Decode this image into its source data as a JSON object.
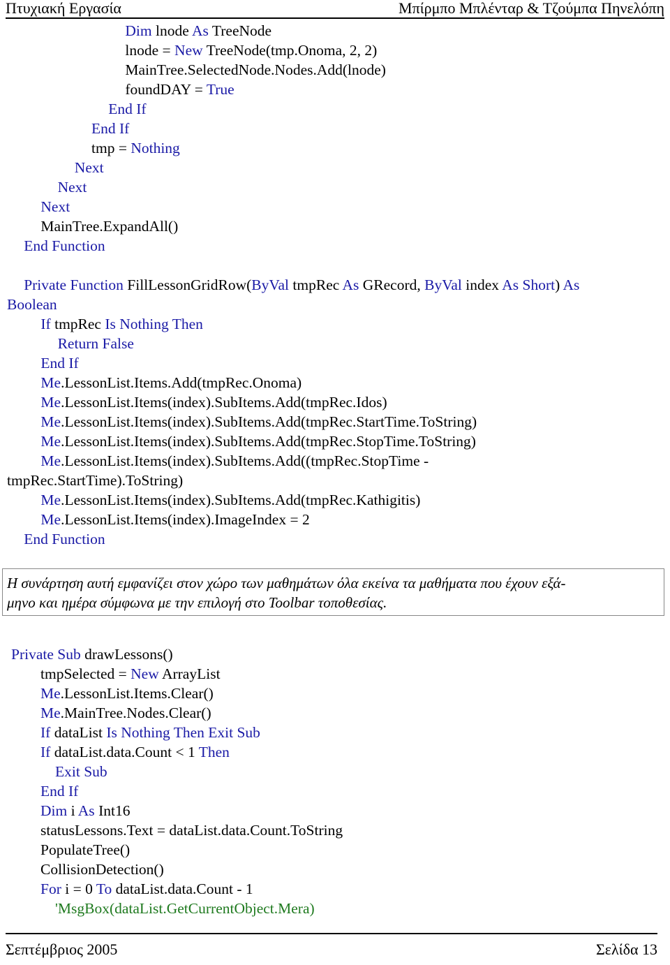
{
  "header": {
    "left": "Πτυχιακή Εργασία",
    "right": "Μπίρμπο Μπλένταρ & Τζούμπα Πηνελόπη"
  },
  "code_lines": [
    {
      "indent": 7,
      "segments": [
        {
          "t": "Dim",
          "k": "kw"
        },
        {
          "t": " lnode ",
          "k": "pl"
        },
        {
          "t": "As",
          "k": "kw"
        },
        {
          "t": " TreeNode",
          "k": "pl"
        }
      ]
    },
    {
      "indent": 7,
      "segments": [
        {
          "t": "lnode = ",
          "k": "pl"
        },
        {
          "t": "New",
          "k": "kw"
        },
        {
          "t": " TreeNode(tmp.Onoma, 2, 2)",
          "k": "pl"
        }
      ]
    },
    {
      "indent": 7,
      "segments": [
        {
          "t": "MainTree.SelectedNode.Nodes.Add(lnode)",
          "k": "pl"
        }
      ]
    },
    {
      "indent": 7,
      "segments": [
        {
          "t": "foundDAY = ",
          "k": "pl"
        },
        {
          "t": "True",
          "k": "kw"
        }
      ]
    },
    {
      "indent": 6,
      "segments": [
        {
          "t": "End If",
          "k": "kw"
        }
      ]
    },
    {
      "indent": 5,
      "segments": [
        {
          "t": "End If",
          "k": "kw"
        }
      ]
    },
    {
      "indent": 5,
      "segments": [
        {
          "t": "tmp = ",
          "k": "pl"
        },
        {
          "t": "Nothing",
          "k": "kw"
        }
      ]
    },
    {
      "indent": 4,
      "segments": [
        {
          "t": "Next",
          "k": "kw"
        }
      ]
    },
    {
      "indent": 3,
      "segments": [
        {
          "t": "Next",
          "k": "kw"
        }
      ]
    },
    {
      "indent": 2,
      "segments": [
        {
          "t": "Next",
          "k": "kw"
        }
      ]
    },
    {
      "indent": 2,
      "segments": [
        {
          "t": "MainTree.ExpandAll()",
          "k": "pl"
        }
      ]
    },
    {
      "indent": 1,
      "segments": [
        {
          "t": "End Function",
          "k": "kw"
        }
      ]
    },
    {
      "indent": 0,
      "segments": []
    },
    {
      "indent": 1,
      "segments": [
        {
          "t": "Private Function",
          "k": "kw"
        },
        {
          "t": " FillLessonGridRow(",
          "k": "pl"
        },
        {
          "t": "ByVal",
          "k": "kw"
        },
        {
          "t": " tmpRec ",
          "k": "pl"
        },
        {
          "t": "As",
          "k": "kw"
        },
        {
          "t": " GRecord, ",
          "k": "pl"
        },
        {
          "t": "ByVal",
          "k": "kw"
        },
        {
          "t": " index ",
          "k": "pl"
        },
        {
          "t": "As Short",
          "k": "kw"
        },
        {
          "t": ") ",
          "k": "pl"
        },
        {
          "t": "As",
          "k": "kw"
        }
      ]
    },
    {
      "indent": 0,
      "segments": [
        {
          "t": "Boolean",
          "k": "kw"
        }
      ]
    },
    {
      "indent": 2,
      "segments": [
        {
          "t": "If",
          "k": "kw"
        },
        {
          "t": " tmpRec ",
          "k": "pl"
        },
        {
          "t": "Is Nothing Then",
          "k": "kw"
        }
      ]
    },
    {
      "indent": 3,
      "segments": [
        {
          "t": "Return False",
          "k": "kw"
        }
      ]
    },
    {
      "indent": 2,
      "segments": [
        {
          "t": "End If",
          "k": "kw"
        }
      ]
    },
    {
      "indent": 2,
      "segments": [
        {
          "t": "Me",
          "k": "kw"
        },
        {
          "t": ".LessonList.Items.Add(tmpRec.Onoma)",
          "k": "pl"
        }
      ]
    },
    {
      "indent": 2,
      "segments": [
        {
          "t": "Me",
          "k": "kw"
        },
        {
          "t": ".LessonList.Items(index).SubItems.Add(tmpRec.Idos)",
          "k": "pl"
        }
      ]
    },
    {
      "indent": 2,
      "segments": [
        {
          "t": "Me",
          "k": "kw"
        },
        {
          "t": ".LessonList.Items(index).SubItems.Add(tmpRec.StartTime.ToString)",
          "k": "pl"
        }
      ]
    },
    {
      "indent": 2,
      "segments": [
        {
          "t": "Me",
          "k": "kw"
        },
        {
          "t": ".LessonList.Items(index).SubItems.Add(tmpRec.StopTime.ToString)",
          "k": "pl"
        }
      ]
    },
    {
      "indent": 2,
      "segments": [
        {
          "t": "Me",
          "k": "kw"
        },
        {
          "t": ".LessonList.Items(index).SubItems.Add((tmpRec.StopTime -",
          "k": "pl"
        }
      ]
    },
    {
      "indent": 0,
      "segments": [
        {
          "t": "tmpRec.StartTime).ToString)",
          "k": "pl"
        }
      ]
    },
    {
      "indent": 2,
      "segments": [
        {
          "t": "Me",
          "k": "kw"
        },
        {
          "t": ".LessonList.Items(index).SubItems.Add(tmpRec.Kathigitis)",
          "k": "pl"
        }
      ]
    },
    {
      "indent": 2,
      "segments": [
        {
          "t": "Me",
          "k": "kw"
        },
        {
          "t": ".LessonList.Items(index).ImageIndex = 2",
          "k": "pl"
        }
      ]
    },
    {
      "indent": 1,
      "segments": [
        {
          "t": "End Function",
          "k": "kw"
        }
      ]
    }
  ],
  "note": {
    "line1": "Η συνάρτηση αυτή εμφανίζει στον χώρο των μαθημάτων όλα εκείνα τα μαθήματα που έχουν εξά-",
    "line2": "μηνο και ημέρα σύμφωνα με την επιλογή  στο Toolbar τοποθεσίας."
  },
  "code_lines_2": [
    {
      "indent": 0,
      "segments": [
        {
          "t": "Private Sub",
          "k": "kw"
        },
        {
          "t": " drawLessons()",
          "k": "pl"
        }
      ]
    },
    {
      "indent": 2,
      "segments": [
        {
          "t": "tmpSelected = ",
          "k": "pl"
        },
        {
          "t": "New",
          "k": "kw"
        },
        {
          "t": " ArrayList",
          "k": "pl"
        }
      ]
    },
    {
      "indent": 2,
      "segments": [
        {
          "t": "Me",
          "k": "kw"
        },
        {
          "t": ".LessonList.Items.Clear()",
          "k": "pl"
        }
      ]
    },
    {
      "indent": 2,
      "segments": [
        {
          "t": "Me",
          "k": "kw"
        },
        {
          "t": ".MainTree.Nodes.Clear()",
          "k": "pl"
        }
      ]
    },
    {
      "indent": 2,
      "segments": [
        {
          "t": "If",
          "k": "kw"
        },
        {
          "t": " dataList ",
          "k": "pl"
        },
        {
          "t": "Is Nothing Then Exit Sub",
          "k": "kw"
        }
      ]
    },
    {
      "indent": 2,
      "segments": [
        {
          "t": "If",
          "k": "kw"
        },
        {
          "t": " dataList.data.Count < 1 ",
          "k": "pl"
        },
        {
          "t": "Then",
          "k": "kw"
        }
      ]
    },
    {
      "indent": 3,
      "segments": [
        {
          "t": "Exit Sub",
          "k": "kw"
        }
      ]
    },
    {
      "indent": 2,
      "segments": [
        {
          "t": "End If",
          "k": "kw"
        }
      ]
    },
    {
      "indent": 2,
      "segments": [
        {
          "t": "Dim",
          "k": "kw"
        },
        {
          "t": " i ",
          "k": "pl"
        },
        {
          "t": "As",
          "k": "kw"
        },
        {
          "t": " Int16",
          "k": "pl"
        }
      ]
    },
    {
      "indent": 2,
      "segments": [
        {
          "t": "statusLessons.Text = dataList.data.Count.ToString",
          "k": "pl"
        }
      ]
    },
    {
      "indent": 2,
      "segments": [
        {
          "t": "PopulateTree()",
          "k": "pl"
        }
      ]
    },
    {
      "indent": 2,
      "segments": [
        {
          "t": "CollisionDetection()",
          "k": "pl"
        }
      ]
    },
    {
      "indent": 2,
      "segments": [
        {
          "t": "For",
          "k": "kw"
        },
        {
          "t": " i = 0 ",
          "k": "pl"
        },
        {
          "t": "To",
          "k": "kw"
        },
        {
          "t": " dataList.data.Count - 1",
          "k": "pl"
        }
      ]
    },
    {
      "indent": 3,
      "segments": [
        {
          "t": "'MsgBox(dataList.GetCurrentObject.Mera)",
          "k": "cm"
        }
      ]
    }
  ],
  "footer": {
    "left": "Σεπτέμβριος 2005",
    "right": "Σελίδα 13"
  },
  "colors": {
    "keyword": "#1a1aa6",
    "comment": "#1f7a1f",
    "text": "#000000"
  }
}
